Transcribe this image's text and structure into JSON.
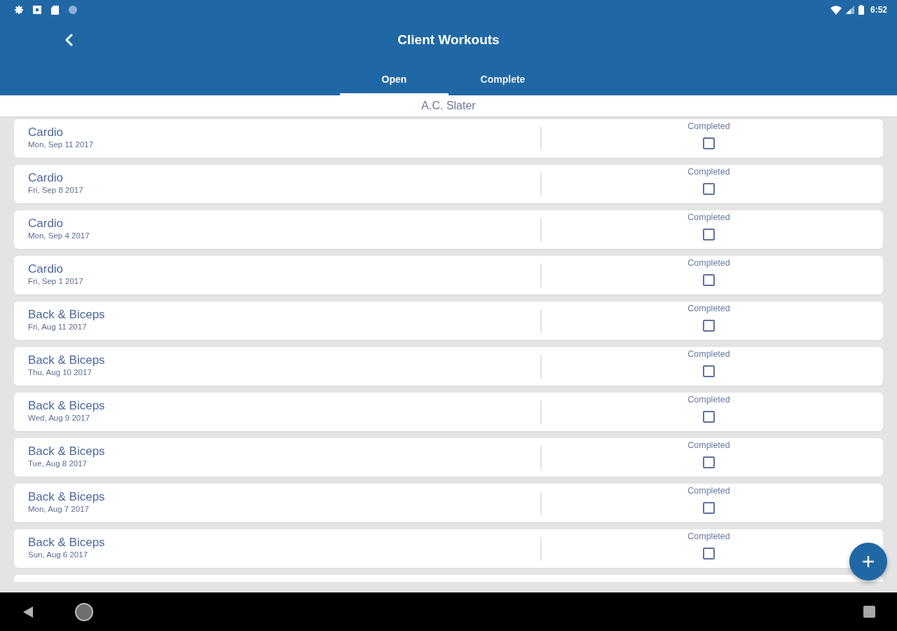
{
  "status_bar": {
    "time": "6:52"
  },
  "app_bar": {
    "title": "Client Workouts",
    "tabs": [
      {
        "label": "Open",
        "selected": true
      },
      {
        "label": "Complete",
        "selected": false
      }
    ]
  },
  "client": {
    "name": "A.C. Slater"
  },
  "workouts": [
    {
      "name": "Cardio",
      "date": "Mon, Sep 11 2017",
      "status_label": "Completed",
      "checked": false
    },
    {
      "name": "Cardio",
      "date": "Fri, Sep 8 2017",
      "status_label": "Completed",
      "checked": false
    },
    {
      "name": "Cardio",
      "date": "Mon, Sep 4 2017",
      "status_label": "Completed",
      "checked": false
    },
    {
      "name": "Cardio",
      "date": "Fri, Sep 1 2017",
      "status_label": "Completed",
      "checked": false
    },
    {
      "name": "Back & Biceps",
      "date": "Fri, Aug 11 2017",
      "status_label": "Completed",
      "checked": false
    },
    {
      "name": "Back & Biceps",
      "date": "Thu, Aug 10 2017",
      "status_label": "Completed",
      "checked": false
    },
    {
      "name": "Back & Biceps",
      "date": "Wed, Aug 9 2017",
      "status_label": "Completed",
      "checked": false
    },
    {
      "name": "Back & Biceps",
      "date": "Tue, Aug 8 2017",
      "status_label": "Completed",
      "checked": false
    },
    {
      "name": "Back & Biceps",
      "date": "Mon, Aug 7 2017",
      "status_label": "Completed",
      "checked": false
    },
    {
      "name": "Back & Biceps",
      "date": "Sun, Aug 6 2017",
      "status_label": "Completed",
      "checked": false
    }
  ]
}
